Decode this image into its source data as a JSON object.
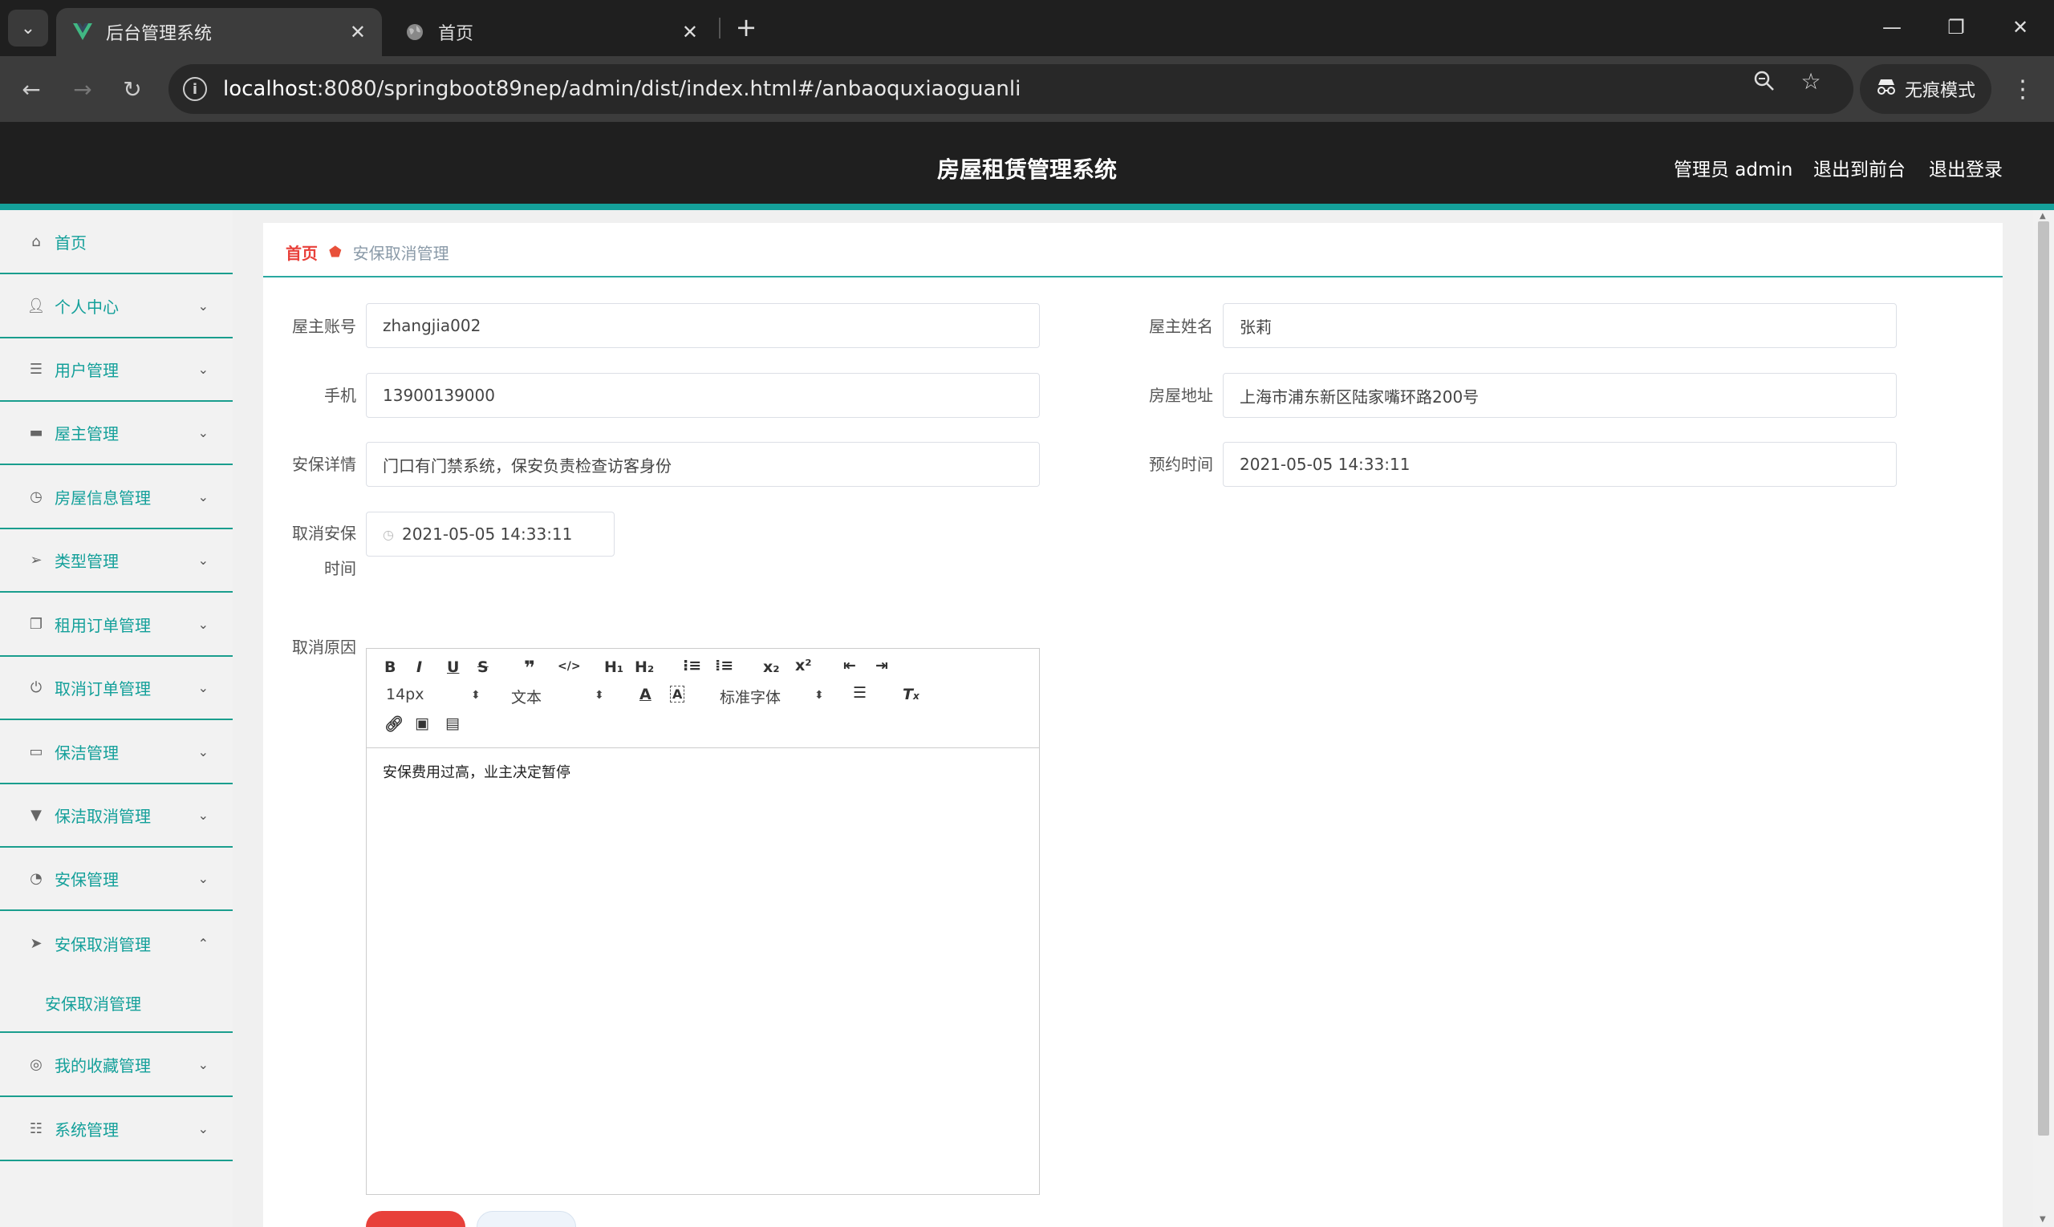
{
  "browser": {
    "tabs": [
      {
        "title": "后台管理系统",
        "active": true
      },
      {
        "title": "首页",
        "active": false
      }
    ],
    "url_host": "localhost",
    "url_rest": ":8080/springboot89nep/admin/dist/index.html#/anbaoquxiaoguanli",
    "incognito_label": "无痕模式"
  },
  "header": {
    "title": "房屋租赁管理系统",
    "admin_label": "管理员 admin",
    "to_front": "退出到前台",
    "logout": "退出登录"
  },
  "sidebar": {
    "items": [
      {
        "label": "首页",
        "icon": "home-icon"
      },
      {
        "label": "个人中心",
        "icon": "user-icon"
      },
      {
        "label": "用户管理",
        "icon": "list-icon"
      },
      {
        "label": "屋主管理",
        "icon": "briefcase-icon"
      },
      {
        "label": "房屋信息管理",
        "icon": "clock-icon"
      },
      {
        "label": "类型管理",
        "icon": "send-icon"
      },
      {
        "label": "租用订单管理",
        "icon": "copy-icon"
      },
      {
        "label": "取消订单管理",
        "icon": "power-icon"
      },
      {
        "label": "保洁管理",
        "icon": "chat-icon"
      },
      {
        "label": "保洁取消管理",
        "icon": "brush-icon"
      },
      {
        "label": "安保管理",
        "icon": "odometer-icon"
      },
      {
        "label": "安保取消管理",
        "icon": "paper-plane-icon"
      },
      {
        "label": "我的收藏管理",
        "icon": "compass-icon"
      },
      {
        "label": "系统管理",
        "icon": "sliders-icon"
      }
    ],
    "sub_item": "安保取消管理"
  },
  "breadcrumb": {
    "home": "首页",
    "current": "安保取消管理"
  },
  "form": {
    "owner_account_label": "屋主账号",
    "owner_account": "zhangjia002",
    "owner_name_label": "屋主姓名",
    "owner_name": "张莉",
    "phone_label": "手机",
    "phone": "13900139000",
    "address_label": "房屋地址",
    "address": "上海市浦东新区陆家嘴环路200号",
    "security_detail_label": "安保详情",
    "security_detail": "门口有门禁系统，保安负责检查访客身份",
    "appointment_label": "预约时间",
    "appointment": "2021-05-05 14:33:11",
    "cancel_time_label_1": "取消安保",
    "cancel_time_label_2": "时间",
    "cancel_time": "2021-05-05 14:33:11",
    "cancel_reason_label": "取消原因",
    "cancel_reason": "安保费用过高，业主决定暂停"
  },
  "editor": {
    "font_size": "14px",
    "text_style": "文本",
    "font_family": "标准字体"
  },
  "colors": {
    "accent": "#14a09a",
    "header_bg": "#1f1f1f",
    "danger": "#e8403a"
  }
}
